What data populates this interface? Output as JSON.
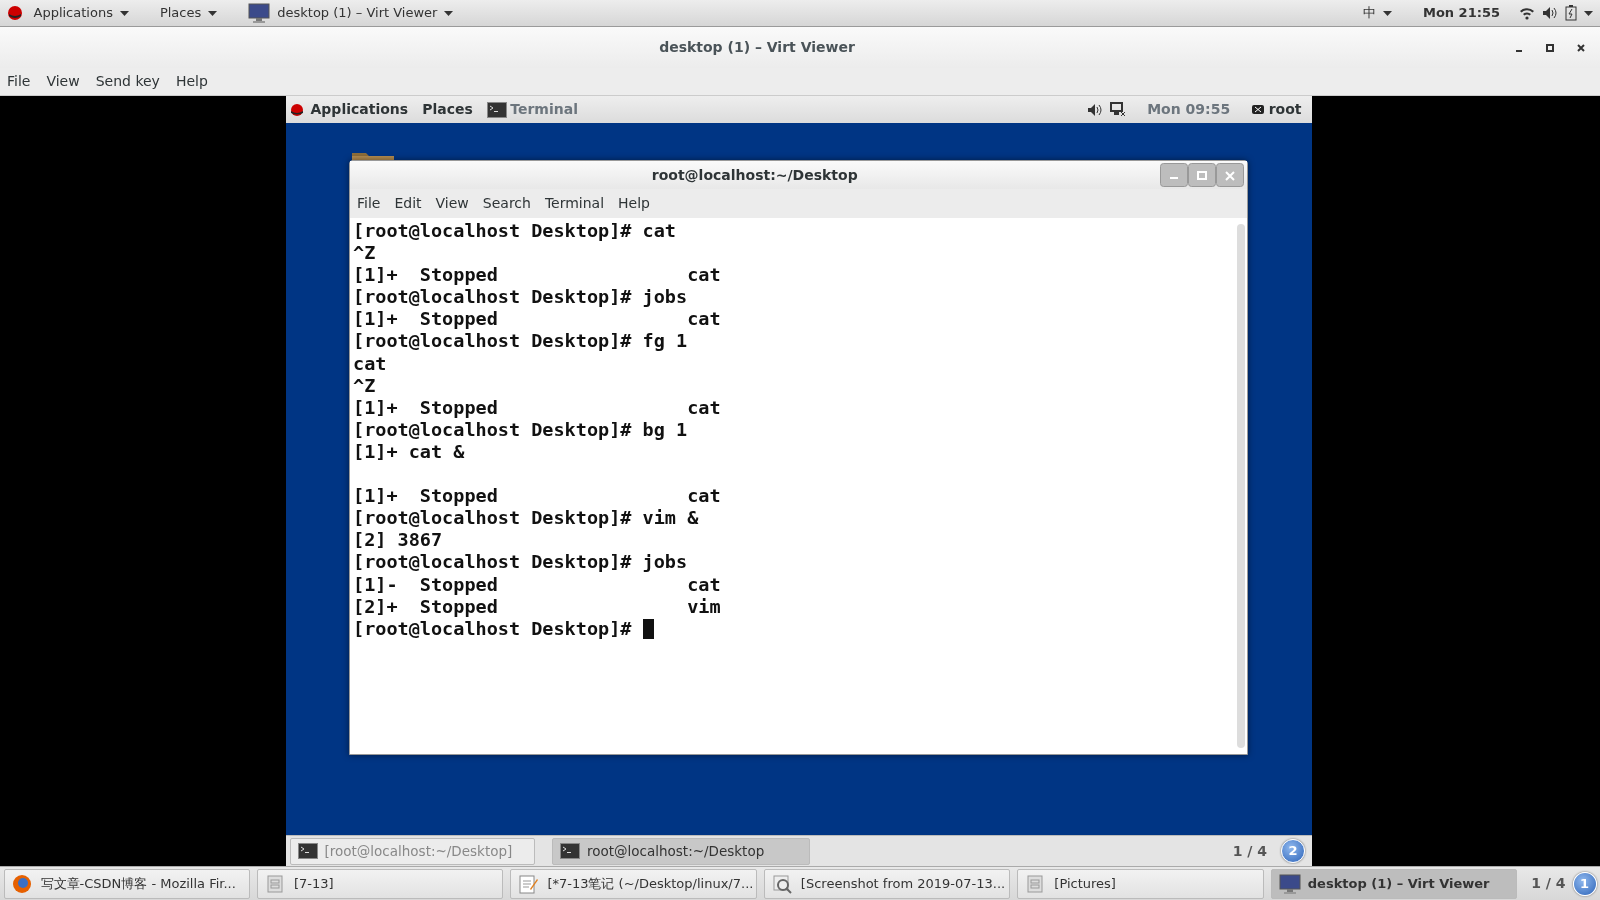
{
  "host_top_bar": {
    "applications": "Applications",
    "places": "Places",
    "window_menu": "desktop (1) – Virt Viewer",
    "input_method": "中",
    "clock": "Mon 21:55"
  },
  "viewer": {
    "title": "desktop (1) – Virt Viewer",
    "menu": [
      "File",
      "View",
      "Send key",
      "Help"
    ]
  },
  "guest": {
    "top_bar": {
      "applications": "Applications",
      "places": "Places",
      "app": "Terminal",
      "clock": "Mon 09:55",
      "user": "root"
    },
    "terminal": {
      "title": "root@localhost:~/Desktop",
      "menu": [
        "File",
        "Edit",
        "View",
        "Search",
        "Terminal",
        "Help"
      ],
      "blocks": [
        [
          "[root@localhost Desktop]# cat",
          "^Z",
          "[1]+  Stopped                 cat",
          "[root@localhost Desktop]# jobs",
          "[1]+  Stopped                 cat",
          "[root@localhost Desktop]# fg 1",
          "cat",
          "^Z",
          "[1]+  Stopped                 cat",
          "[root@localhost Desktop]# bg 1",
          "[1]+ cat &"
        ],
        [
          "[1]+  Stopped                 cat",
          "[root@localhost Desktop]# vim &",
          "[2] 3867",
          "[root@localhost Desktop]# jobs",
          "[1]-  Stopped                 cat",
          "[2]+  Stopped                 vim",
          "[root@localhost Desktop]# "
        ]
      ],
      "cursor": true
    },
    "window_list": [
      {
        "label": "[root@localhost:~/Desktop]",
        "selected": false
      },
      {
        "label": "root@localhost:~/Desktop",
        "selected": true
      }
    ],
    "workspace": "1 / 4",
    "notification_count": "2"
  },
  "host_taskbar": {
    "items": [
      {
        "kind": "browser",
        "label": "写文章-CSDN博客 - Mozilla Fir...",
        "selected": false
      },
      {
        "kind": "folder",
        "label": "[7-13]",
        "selected": false
      },
      {
        "kind": "editor",
        "label": "[*7-13笔记 (~/Desktop/linux/7...",
        "selected": false
      },
      {
        "kind": "viewer",
        "label": "[Screenshot from 2019-07-13...",
        "selected": false
      },
      {
        "kind": "folder",
        "label": "[Pictures]",
        "selected": false
      },
      {
        "kind": "monitor",
        "label": "desktop (1) – Virt Viewer",
        "selected": true
      }
    ],
    "workspace": "1 / 4",
    "notification_count": "1"
  }
}
